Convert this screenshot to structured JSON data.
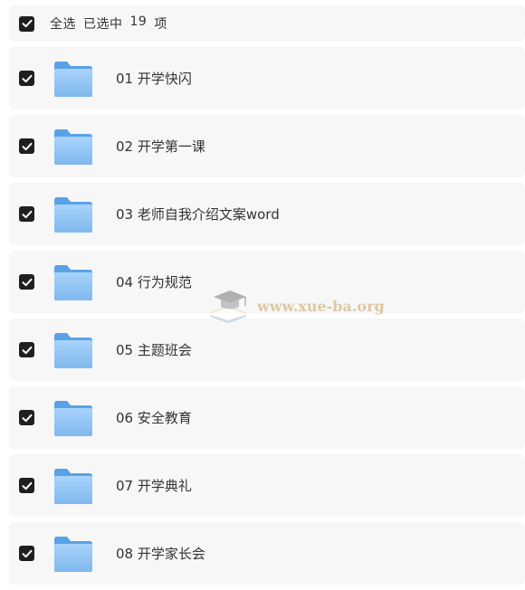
{
  "header": {
    "select_all": "全选",
    "selected_prefix": "已选中",
    "selected_count": "19",
    "selected_suffix": "项"
  },
  "folders": [
    {
      "name": "01 开学快闪"
    },
    {
      "name": "02 开学第一课"
    },
    {
      "name": "03 老师自我介绍文案word"
    },
    {
      "name": "04 行为规范"
    },
    {
      "name": "05 主题班会"
    },
    {
      "name": "06 安全教育"
    },
    {
      "name": "07 开学典礼"
    },
    {
      "name": "08 开学家长会"
    }
  ],
  "watermark": {
    "text": "www.xue-ba.org"
  },
  "colors": {
    "checkbox": "#1f1f1f",
    "row_bg": "#f7f7f8",
    "folder": "#7fb8ee"
  }
}
